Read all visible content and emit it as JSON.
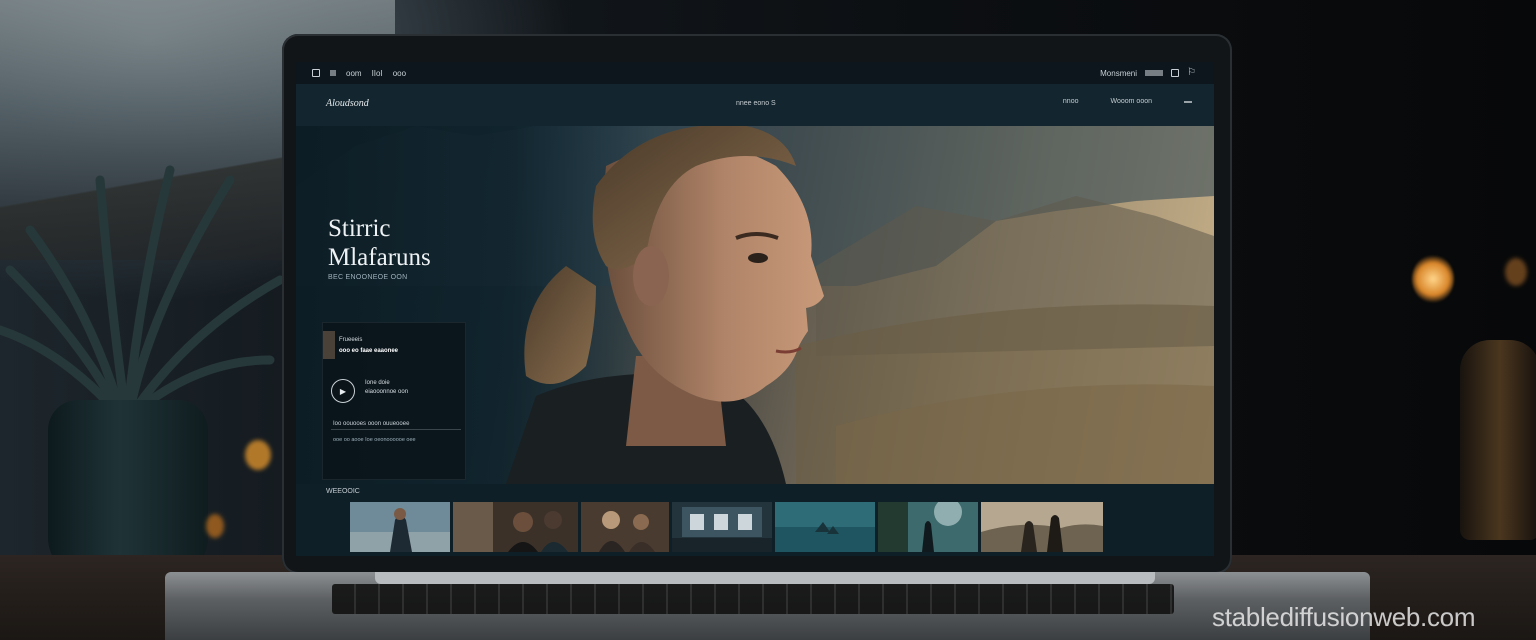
{
  "os_bar": {
    "left_items": [
      "oom",
      "IIoI",
      "ooo"
    ],
    "right_label": "Monsmeni"
  },
  "nav": {
    "brand": "Aloudsond",
    "center": "nnee eono S",
    "links": [
      "nnoo",
      "Wooom ooon"
    ]
  },
  "hero": {
    "title_line1": "Stirric",
    "title_line2": "Mlafaruns",
    "subtitle": "BEC ENOONEOE OON",
    "card": {
      "line1": "Frueeeis",
      "line2": "ooo eo faae eaaonee",
      "item_line1": "Ione doie",
      "item_line2": "eiaooonnoe oon",
      "line3": "Ioo oouooes ooon ouueooee",
      "line4": "ooe oo aooe  Ioe oeonoooooe oee"
    }
  },
  "gallery": {
    "label": "WEEOOIC",
    "thumb_count": 7
  },
  "watermark": "stablediffusionweb.com",
  "colors": {
    "screen_bg": "#0e1c24",
    "nav_bg": "#13252e",
    "hero_warm": "#c7b08a"
  }
}
